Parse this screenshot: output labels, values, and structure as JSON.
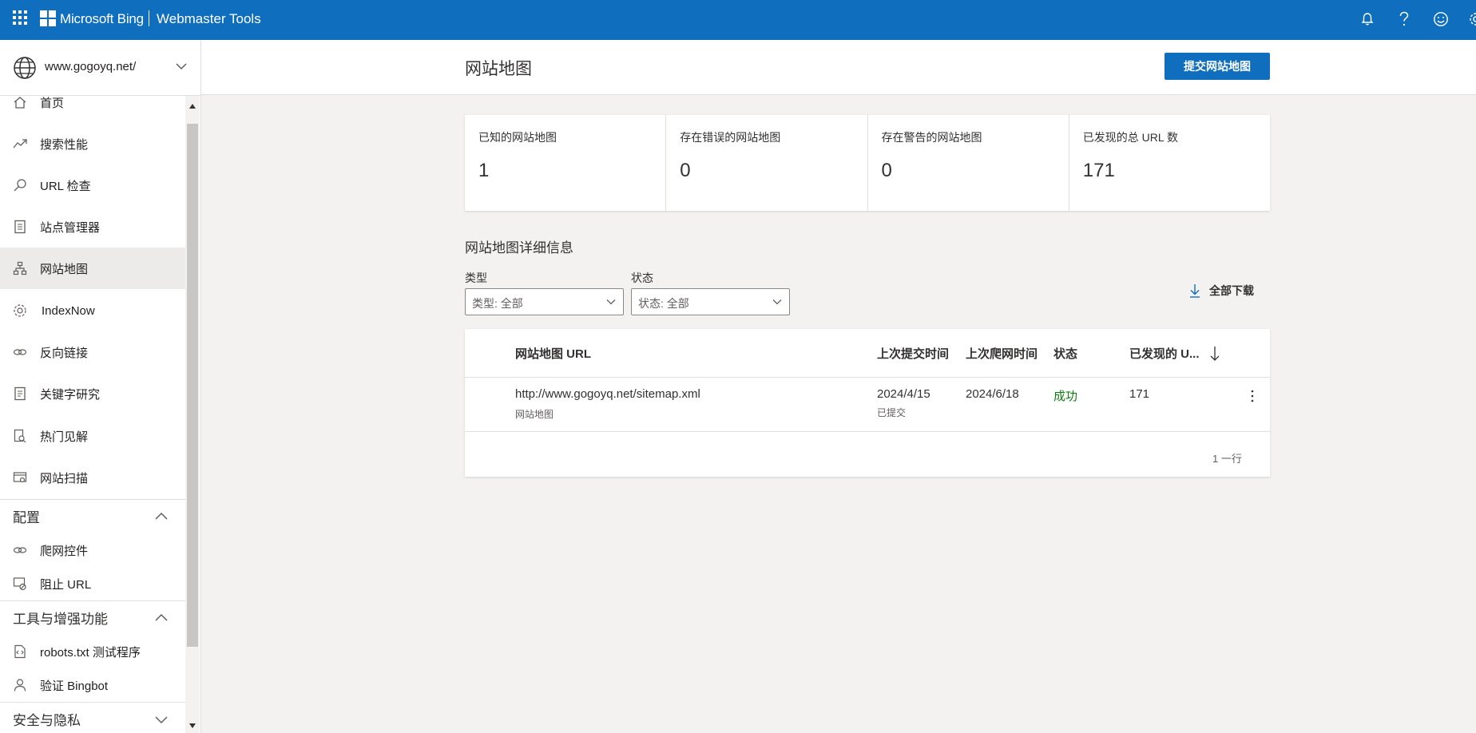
{
  "topbar": {
    "brand": "Microsoft Bing",
    "product": "Webmaster Tools",
    "icons": [
      "bell-icon",
      "help-icon",
      "feedback-smiley-icon",
      "settings-gear-icon"
    ]
  },
  "site": {
    "url": "www.gogoyq.net/"
  },
  "nav": {
    "items": [
      {
        "label": "首页",
        "icon": "home-icon"
      },
      {
        "label": "搜索性能",
        "icon": "trend-icon"
      },
      {
        "label": "URL 检查",
        "icon": "search-icon"
      },
      {
        "label": "站点管理器",
        "icon": "site-explorer-icon"
      },
      {
        "label": "网站地图",
        "icon": "sitemap-icon",
        "active": true
      },
      {
        "label": "IndexNow",
        "icon": "gear-icon"
      },
      {
        "label": "反向链接",
        "icon": "link-icon"
      },
      {
        "label": "关键字研究",
        "icon": "document-icon"
      },
      {
        "label": "热门见解",
        "icon": "insights-icon"
      },
      {
        "label": "网站扫描",
        "icon": "scan-icon"
      }
    ],
    "sections": {
      "config": {
        "label": "配置",
        "items": [
          {
            "label": "爬网控件",
            "icon": "crawl-icon"
          },
          {
            "label": "阻止 URL",
            "icon": "block-icon"
          }
        ]
      },
      "tools": {
        "label": "工具与增强功能",
        "items": [
          {
            "label": "robots.txt 测试程序",
            "icon": "robots-icon"
          },
          {
            "label": "验证 Bingbot",
            "icon": "bot-icon"
          }
        ]
      },
      "security": {
        "label": "安全与隐私"
      }
    }
  },
  "page": {
    "title": "网站地图",
    "submit_button": "提交网站地图"
  },
  "stats": [
    {
      "label": "已知的网站地图",
      "value": "1"
    },
    {
      "label": "存在错误的网站地图",
      "value": "0"
    },
    {
      "label": "存在警告的网站地图",
      "value": "0"
    },
    {
      "label": "已发现的总 URL 数",
      "value": "171"
    }
  ],
  "details": {
    "title": "网站地图详细信息",
    "filters": {
      "type": {
        "label": "类型",
        "value": "类型: 全部"
      },
      "status": {
        "label": "状态",
        "value": "状态: 全部"
      }
    },
    "download_label": "全部下载"
  },
  "table": {
    "headers": {
      "url": "网站地图 URL",
      "submitted": "上次提交时间",
      "crawled": "上次爬网时间",
      "status": "状态",
      "discovered": "已发现的 U..."
    },
    "rows": [
      {
        "url": "http://www.gogoyq.net/sitemap.xml",
        "type": "网站地图",
        "submitted": "2024/4/15",
        "submitted_note": "已提交",
        "crawled": "2024/6/18",
        "status": "成功",
        "discovered": "171"
      }
    ],
    "row_count": "1 一行"
  },
  "colors": {
    "accent": "#106ebe",
    "success": "#107c10",
    "background": "#f3f2f1"
  }
}
